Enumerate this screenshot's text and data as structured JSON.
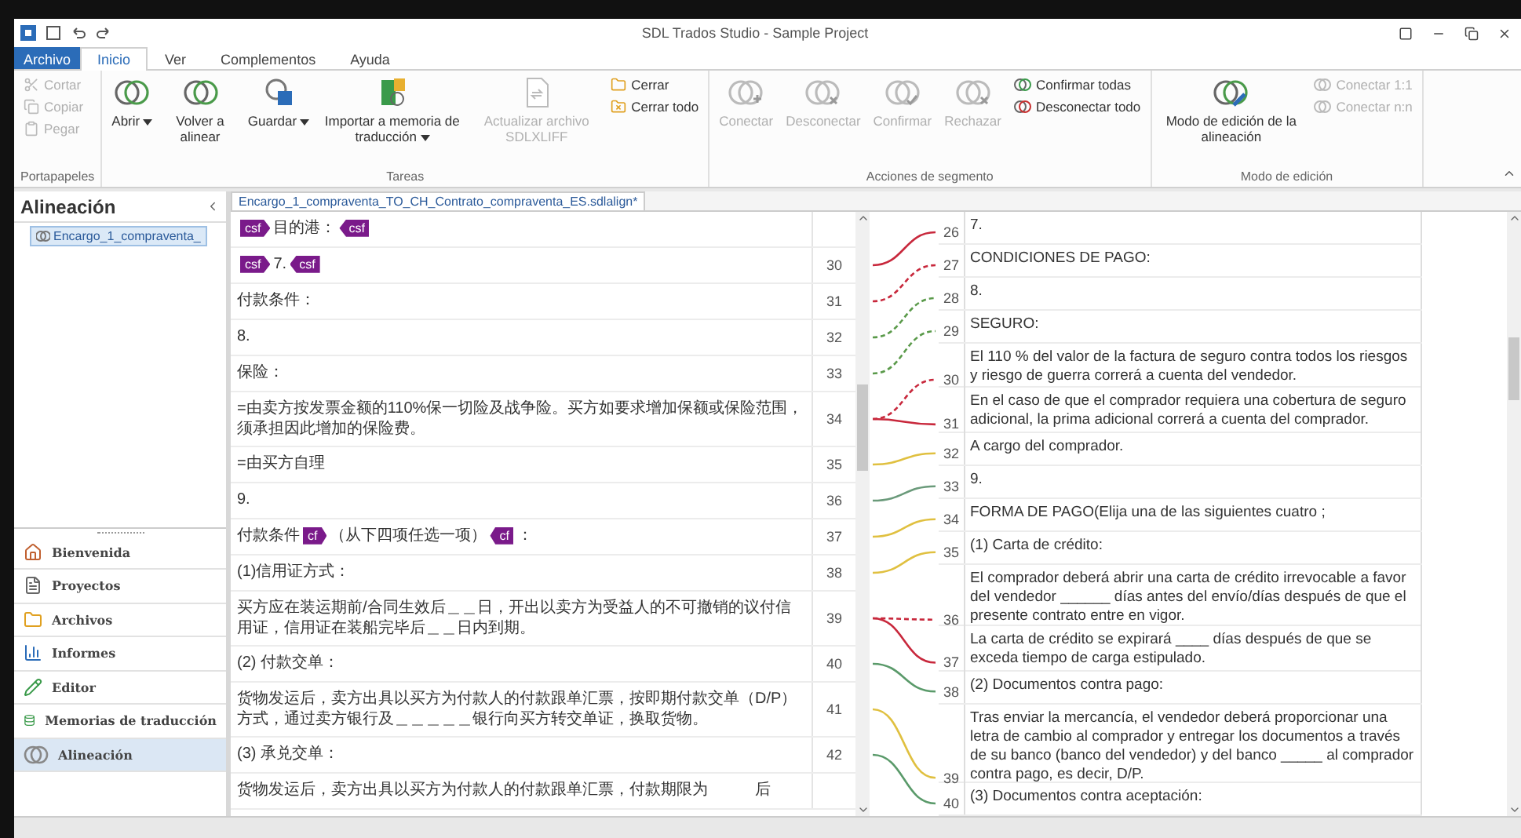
{
  "window": {
    "title": "SDL Trados Studio - Sample Project"
  },
  "menu_tabs": [
    {
      "label": "Archivo",
      "kind": "file",
      "selected": false
    },
    {
      "label": "Inicio",
      "kind": "tab",
      "selected": true
    },
    {
      "label": "Ver",
      "kind": "tab",
      "selected": false
    },
    {
      "label": "Complementos",
      "kind": "tab",
      "selected": false
    },
    {
      "label": "Ayuda",
      "kind": "tab",
      "selected": false
    }
  ],
  "ribbon": {
    "groups": [
      {
        "label": "Portapapeles",
        "items": [
          {
            "kind": "stack",
            "buttons": [
              {
                "label": "Cortar",
                "disabled": true
              },
              {
                "label": "Copiar",
                "disabled": true
              },
              {
                "label": "Pegar",
                "disabled": true
              }
            ]
          }
        ]
      },
      {
        "label": "Tareas",
        "items": [
          {
            "kind": "large",
            "label": "Abrir",
            "dropdown": true,
            "disabled": false
          },
          {
            "kind": "large",
            "label": "Volver a alinear",
            "dropdown": false,
            "disabled": false
          },
          {
            "kind": "large",
            "label": "Guardar",
            "dropdown": true,
            "disabled": false
          },
          {
            "kind": "large",
            "label": "Importar a memoria de traducción",
            "dropdown": true,
            "disabled": false
          },
          {
            "kind": "large",
            "label": "Actualizar archivo SDLXLIFF",
            "dropdown": false,
            "disabled": true
          },
          {
            "kind": "stack",
            "buttons": [
              {
                "label": "Cerrar",
                "disabled": false
              },
              {
                "label": "Cerrar todo",
                "disabled": false
              }
            ]
          }
        ]
      },
      {
        "label": "Acciones de segmento",
        "items": [
          {
            "kind": "large",
            "label": "Conectar",
            "dropdown": false,
            "disabled": true
          },
          {
            "kind": "large",
            "label": "Desconectar",
            "dropdown": false,
            "disabled": true
          },
          {
            "kind": "large",
            "label": "Confirmar",
            "dropdown": false,
            "disabled": true
          },
          {
            "kind": "large",
            "label": "Rechazar",
            "dropdown": false,
            "disabled": true
          },
          {
            "kind": "stack",
            "buttons": [
              {
                "label": "Confirmar todas",
                "disabled": false
              },
              {
                "label": "Desconectar todo",
                "disabled": false
              }
            ]
          }
        ]
      },
      {
        "label": "Modo de edición",
        "items": [
          {
            "kind": "large",
            "label": "Modo de edición de la alineación",
            "dropdown": false,
            "disabled": false
          },
          {
            "kind": "stack",
            "buttons": [
              {
                "label": "Conectar 1:1",
                "disabled": true
              },
              {
                "label": "Conectar n:n",
                "disabled": true
              }
            ]
          }
        ]
      }
    ]
  },
  "sidebar": {
    "title": "Alineación",
    "tree": [
      {
        "label": "Encargo_1_compraventa_",
        "selected": true
      }
    ],
    "nav": [
      {
        "label": "Bienvenida",
        "selected": false
      },
      {
        "label": "Proyectos",
        "selected": false
      },
      {
        "label": "Archivos",
        "selected": false
      },
      {
        "label": "Informes",
        "selected": false
      },
      {
        "label": "Editor",
        "selected": false
      },
      {
        "label": "Memorias de traducción",
        "selected": false
      },
      {
        "label": "Alineación",
        "selected": true
      }
    ]
  },
  "document": {
    "tab": "Encargo_1_compraventa_TO_CH_Contrato_compraventa_ES.sdlalign*",
    "source_rows": [
      {
        "segments": [
          {
            "kind": "open_tag",
            "text": "csf"
          },
          {
            "kind": "text",
            "text": "目的港："
          },
          {
            "kind": "close_tag",
            "text": "csf"
          }
        ]
      },
      {
        "number": "30",
        "segments": [
          {
            "kind": "open_tag",
            "text": "csf"
          },
          {
            "kind": "text",
            "text": "7."
          },
          {
            "kind": "close_tag",
            "text": "csf"
          }
        ],
        "connections": [
          {
            "color": "#c8283c",
            "kind": "solid"
          }
        ]
      },
      {
        "number": "31",
        "segments": [
          {
            "kind": "text",
            "text": "付款条件："
          }
        ],
        "connections": [
          {
            "color": "#c8283c",
            "kind": "dashed"
          }
        ]
      },
      {
        "number": "32",
        "segments": [
          {
            "kind": "text",
            "text": "8."
          }
        ],
        "connections": [
          {
            "color": "#5a9a4a",
            "kind": "dashed"
          }
        ]
      },
      {
        "number": "33",
        "segments": [
          {
            "kind": "text",
            "text": "保险："
          }
        ],
        "connections": [
          {
            "color": "#5a9a4a",
            "kind": "dashed"
          }
        ]
      },
      {
        "number": "34",
        "segments": [
          {
            "kind": "text",
            "text": "=由卖方按发票金额的110%保一切险及战争险。买方如要求增加保额或保险范围，须承担因此增加的保险费。"
          }
        ],
        "connections": [
          {
            "color": "#c8283c",
            "kind": "dashed"
          },
          {
            "color": "#c8283c",
            "kind": "solid"
          }
        ]
      },
      {
        "number": "35",
        "segments": [
          {
            "kind": "text",
            "text": "=由买方自理"
          }
        ],
        "connections": [
          {
            "color": "#e0c040",
            "kind": "solid"
          }
        ]
      },
      {
        "number": "36",
        "segments": [
          {
            "kind": "text",
            "text": "9."
          }
        ],
        "connections": [
          {
            "color": "#6a9a7a",
            "kind": "solid"
          }
        ]
      },
      {
        "number": "37",
        "segments": [
          {
            "kind": "text",
            "text": "付款条件"
          },
          {
            "kind": "open_tag",
            "text": "cf"
          },
          {
            "kind": "text",
            "text": "（从下四项任选一项）"
          },
          {
            "kind": "close_tag",
            "text": "cf"
          },
          {
            "kind": "text",
            "text": "："
          }
        ],
        "connections": [
          {
            "color": "#e0c040",
            "kind": "solid"
          }
        ]
      },
      {
        "number": "38",
        "segments": [
          {
            "kind": "text",
            "text": "(1)信用证方式："
          }
        ],
        "connections": [
          {
            "color": "#e0c040",
            "kind": "solid"
          }
        ]
      },
      {
        "number": "39",
        "segments": [
          {
            "kind": "text",
            "text": "买方应在装运期前/合同生效后＿＿日，开出以卖方为受益人的不可撤销的议付信用证，信用证在装船完毕后＿＿日内到期。"
          }
        ],
        "connections": [
          {
            "color": "#c8283c",
            "kind": "dashed"
          },
          {
            "color": "#c8283c",
            "kind": "solid"
          }
        ]
      },
      {
        "number": "40",
        "segments": [
          {
            "kind": "text",
            "text": "(2) 付款交单："
          }
        ],
        "connections": [
          {
            "color": "#5a9a6a",
            "kind": "solid"
          }
        ]
      },
      {
        "number": "41",
        "segments": [
          {
            "kind": "text",
            "text": "货物发运后，卖方出具以买方为付款人的付款跟单汇票，按即期付款交单（D/P）方式，通过卖方银行及＿＿＿＿＿银行向买方转交单证，换取货物。"
          }
        ],
        "connections": [
          {
            "color": "#e0c040",
            "kind": "solid"
          }
        ]
      },
      {
        "number": "42",
        "segments": [
          {
            "kind": "text",
            "text": "(3) 承兑交单："
          }
        ],
        "connections": [
          {
            "color": "#5a9a6a",
            "kind": "solid"
          }
        ]
      },
      {
        "segments": [
          {
            "kind": "text",
            "text": "货物发运后，卖方出具以买方为付款人的付款跟单汇票，付款期限为　　　后"
          }
        ]
      }
    ],
    "target_rows": [
      {
        "number": "26",
        "text": "7."
      },
      {
        "number": "27",
        "text": "CONDICIONES DE PAGO:"
      },
      {
        "number": "28",
        "text": "8."
      },
      {
        "number": "29",
        "text": "SEGURO:"
      },
      {
        "number": "30",
        "text": "El 110 % del valor de la factura de seguro contra todos los riesgos y riesgo de guerra correrá a cuenta del vendedor."
      },
      {
        "number": "31",
        "text": "En el caso de que el comprador requiera una cobertura de seguro adicional, la prima adicional correrá a cuenta del comprador."
      },
      {
        "number": "32",
        "text": "A cargo del comprador."
      },
      {
        "number": "33",
        "text": "9."
      },
      {
        "number": "34",
        "text": "FORMA DE PAGO(Elija una de las siguientes cuatro ;"
      },
      {
        "number": "35",
        "text": "(1) Carta de crédito:"
      },
      {
        "number": "36",
        "text": "El comprador deberá abrir una carta de crédito irrevocable a favor del vendedor ______ días antes del envío/días después de que el presente contrato entre en vigor."
      },
      {
        "number": "37",
        "text": "La carta de crédito se expirará ____ días después de que se exceda tiempo de carga estipulado."
      },
      {
        "number": "38",
        "text": "(2) Documentos contra pago:"
      },
      {
        "number": "39",
        "text": "Tras enviar la mercancía, el vendedor deberá proporcionar una letra de cambio al comprador y entregar los documentos a través de su banco (banco del vendedor) y del banco _____ al comprador contra pago, es decir, D/P."
      },
      {
        "number": "40",
        "text": "(3) Documentos contra aceptación:"
      }
    ]
  }
}
